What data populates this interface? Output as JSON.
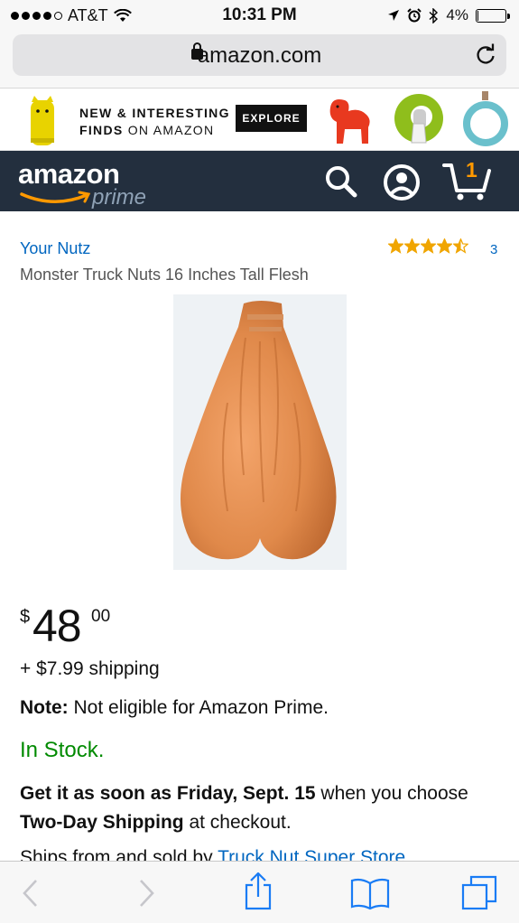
{
  "status_bar": {
    "carrier": "AT&T",
    "time": "10:31 PM",
    "battery": "4%",
    "battery_level": 0.04
  },
  "browser": {
    "url": "amazon.com"
  },
  "banner": {
    "line1_bold": "NEW & INTERESTING",
    "line2_bold": "FINDS",
    "line2_rest": " ON AMAZON",
    "explore": "EXPLORE"
  },
  "header": {
    "logo": "amazon",
    "prime": "prime",
    "cart_count": "1"
  },
  "product": {
    "brand": "Your Nutz",
    "rating": 4.5,
    "review_count": "3",
    "title": "Monster Truck Nuts 16 Inches Tall Flesh",
    "price_symbol": "$",
    "price_whole": "48",
    "price_fraction": "00",
    "shipping": "+ $7.99 shipping",
    "note_label": "Note:",
    "note_text": " Not eligible for Amazon Prime.",
    "stock": "In Stock.",
    "delivery_bold1": "Get it as soon as Friday, Sept. 15",
    "delivery_text1": " when you choose ",
    "delivery_bold2": "Two-Day Shipping",
    "delivery_text2": " at checkout.",
    "sold_by_prefix": "Ships from and sold by ",
    "sold_by_link": "Truck Nut Super Store"
  },
  "colors": {
    "link": "#0066c0",
    "header_bg": "#232f3e",
    "in_stock": "#008a00",
    "star": "#f0a500",
    "safari_blue": "#1a7cf5"
  }
}
